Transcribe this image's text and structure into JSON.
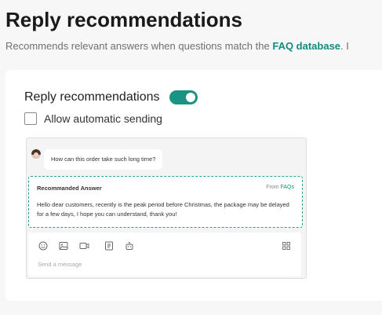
{
  "header": {
    "title": "Reply recommendations",
    "subtitle_prefix": "Recommends relevant answers when questions match the ",
    "subtitle_link": "FAQ database",
    "subtitle_suffix": ". I"
  },
  "settings": {
    "toggle_label": "Reply recommendations",
    "toggle_on": true,
    "checkbox_label": "Allow automatic sending",
    "checkbox_checked": false
  },
  "preview": {
    "customer_message": "How can this order take such long time?",
    "recommendation_title": "Recommanded Answer",
    "source_prefix": "From ",
    "source_link": "FAQs",
    "recommendation_text": "Hello dear customers, recently is the peak period before Christmas, the package may be delayed for a few days, I hope you can understand, thank you!",
    "composer_placeholder": "Send a message",
    "tools": [
      "emoji-icon",
      "image-icon",
      "video-icon",
      "document-icon",
      "robot-icon",
      "grid-icon"
    ]
  },
  "colors": {
    "accent": "#1a9482",
    "link": "#118c7e"
  }
}
